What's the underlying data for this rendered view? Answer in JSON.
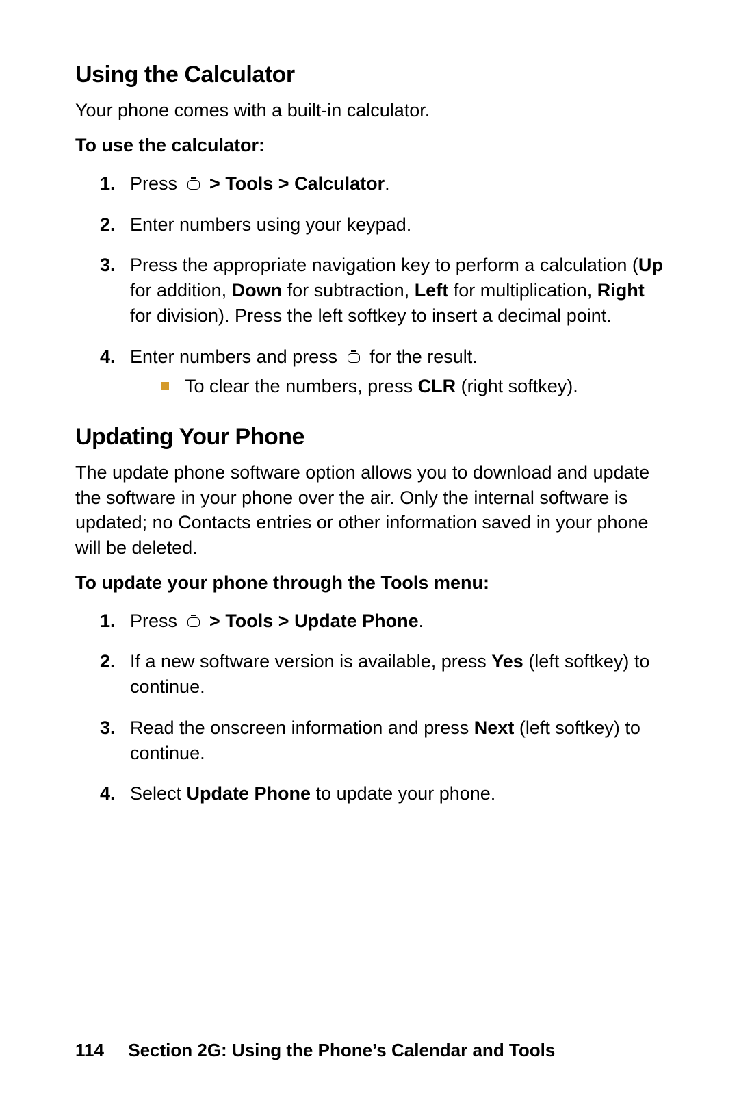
{
  "section1": {
    "heading": "Using the Calculator",
    "intro": "Your phone comes with a built-in calculator.",
    "subhead": "To use the calculator:",
    "steps": [
      {
        "pre": "Press",
        "icon": "nav-button-icon",
        "bold": " > Tools > Calculator",
        "post": "."
      },
      {
        "text": "Enter numbers using your keypad."
      },
      {
        "runs": [
          {
            "t": "Press the appropriate navigation key to perform a calculation ("
          },
          {
            "t": "Up",
            "b": true
          },
          {
            "t": " for addition, "
          },
          {
            "t": "Down",
            "b": true
          },
          {
            "t": " for subtraction, "
          },
          {
            "t": "Left",
            "b": true
          },
          {
            "t": " for multiplication, "
          },
          {
            "t": "Right",
            "b": true
          },
          {
            "t": " for division). Press the left softkey to insert a decimal point."
          }
        ]
      },
      {
        "pre": "Enter numbers and press",
        "icon": "nav-button-icon",
        "post": "for the result.",
        "sub": [
          {
            "runs": [
              {
                "t": "To clear the numbers, press "
              },
              {
                "t": "CLR",
                "b": true
              },
              {
                "t": " (right softkey)."
              }
            ]
          }
        ]
      }
    ]
  },
  "section2": {
    "heading": "Updating Your Phone",
    "intro": "The update phone software option allows you to download and update the software in your phone over the air. Only the internal software is updated; no Contacts entries or other information saved in your phone will be deleted.",
    "subhead": "To update your phone through the Tools menu:",
    "steps": [
      {
        "pre": "Press",
        "icon": "nav-button-icon",
        "bold": " > Tools > Update Phone",
        "post": "."
      },
      {
        "runs": [
          {
            "t": "If a new software version is available, press "
          },
          {
            "t": "Yes",
            "b": true
          },
          {
            "t": " (left softkey) to continue."
          }
        ]
      },
      {
        "runs": [
          {
            "t": "Read the onscreen information and press "
          },
          {
            "t": "Next",
            "b": true
          },
          {
            "t": " (left softkey) to continue."
          }
        ]
      },
      {
        "runs": [
          {
            "t": "Select "
          },
          {
            "t": "Update Phone",
            "b": true
          },
          {
            "t": " to update your phone."
          }
        ]
      }
    ]
  },
  "footer": {
    "page": "114",
    "label": "Section 2G: Using the Phone’s Calendar and Tools"
  }
}
